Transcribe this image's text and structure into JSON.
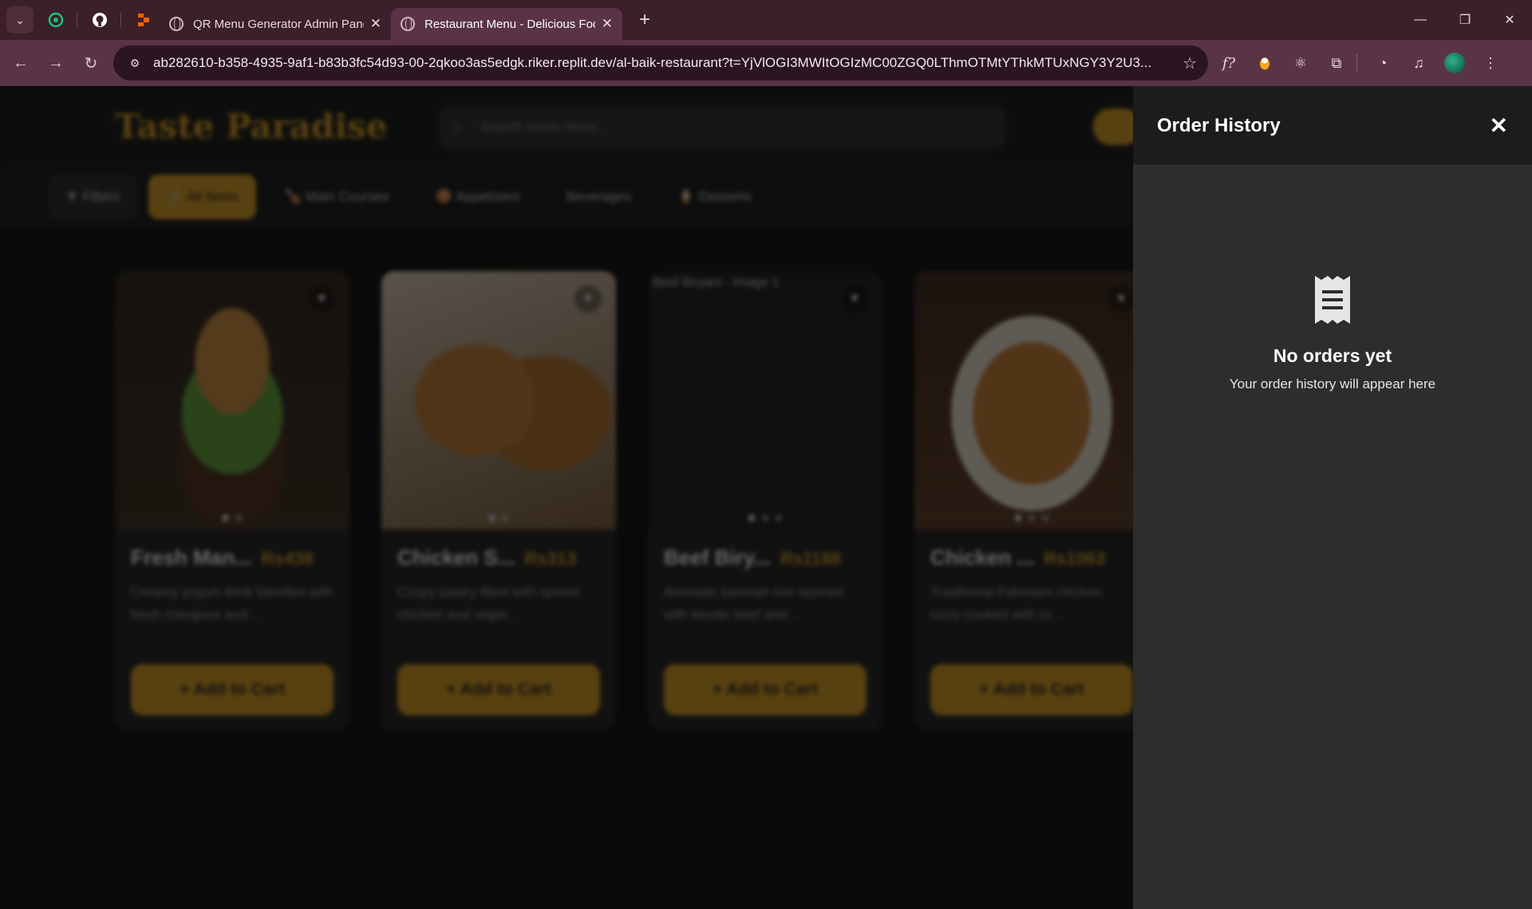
{
  "browser": {
    "tabs": [
      {
        "title": "QR Menu Generator Admin Panel",
        "active": false
      },
      {
        "title": "Restaurant Menu - Delicious Food",
        "active": true
      }
    ],
    "new_tab": "+",
    "url": "ab282610-b358-4935-9af1-b83b3fc54d93-00-2qkoo3as5edgk.riker.replit.dev/al-baik-restaurant?t=YjVlOGI3MWItOGIzMC00ZGQ0LThmOTMtYThkMTUxNGY3Y2U3..."
  },
  "site": {
    "brand": "Taste Paradise",
    "search_placeholder": "Search menu items...",
    "categories": [
      "Filters",
      "All Items",
      "Main Courses",
      "Appetizers",
      "Beverages",
      "Desserts"
    ]
  },
  "menu_items": [
    {
      "name": "Fresh Man...",
      "price": "Rs438",
      "description": "Creamy yogurt drink blended with fresh mangoes and...",
      "add_label": "+ Add to Cart",
      "image": "burger",
      "dots": 2
    },
    {
      "name": "Chicken S...",
      "price": "Rs313",
      "description": "Crispy pastry filled with spiced chicken and veget...",
      "add_label": "+ Add to Cart",
      "image": "samosa",
      "dots": 2
    },
    {
      "name": "Beef Biry...",
      "price": "Rs1188",
      "description": "Aromatic basmati rice layered with tender beef and...",
      "add_label": "+ Add to Cart",
      "image_alt": "Beef Biryani - Image 1",
      "image": "broken",
      "dots": 3
    },
    {
      "name": "Chicken ...",
      "price": "Rs1063",
      "description": "Traditional Pakistani chicken curry cooked with to...",
      "add_label": "+ Add to Cart",
      "image": "curry",
      "dots": 3
    }
  ],
  "order_history": {
    "title": "Order History",
    "close_icon": "close-icon",
    "empty_icon": "receipt-icon",
    "empty_title": "No orders yet",
    "empty_subtitle": "Your order history will appear here"
  },
  "colors": {
    "accent": "#d89b1c",
    "chrome_tabbar": "#3b1f2b",
    "chrome_toolbar": "#5a3344",
    "drawer_bg": "#2d2d2d",
    "drawer_header": "#1c1c1c"
  }
}
